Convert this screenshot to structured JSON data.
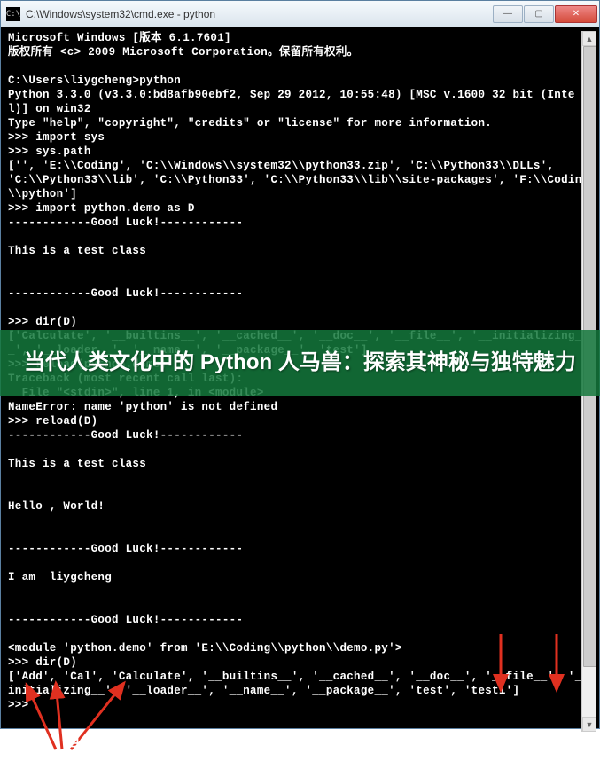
{
  "window": {
    "title": "C:\\Windows\\system32\\cmd.exe - python",
    "icon_glyph": "C:\\",
    "buttons": {
      "minimize": "—",
      "maximize": "▢",
      "close": "✕"
    }
  },
  "terminal": {
    "lines": [
      "Microsoft Windows [版本 6.1.7601]",
      "版权所有 <c> 2009 Microsoft Corporation。保留所有权利。",
      "",
      "C:\\Users\\liygcheng>python",
      "Python 3.3.0 (v3.3.0:bd8afb90ebf2, Sep 29 2012, 10:55:48) [MSC v.1600 32 bit (Intel)] on win32",
      "Type \"help\", \"copyright\", \"credits\" or \"license\" for more information.",
      ">>> import sys",
      ">>> sys.path",
      "['', 'E:\\\\Coding', 'C:\\\\Windows\\\\system32\\\\python33.zip', 'C:\\\\Python33\\\\DLLs', 'C:\\\\Python33\\\\lib', 'C:\\\\Python33', 'C:\\\\Python33\\\\lib\\\\site-packages', 'F:\\\\Coding\\\\python']",
      ">>> import python.demo as D",
      "------------Good Luck!------------",
      "",
      "This is a test class",
      "",
      "",
      "------------Good Luck!------------",
      "",
      ">>> dir(D)",
      "['Calculate', '__builtins__', '__cached__', '__doc__', '__file__', '__initializing__', '__loader__', '__name__', '__package__', 'test']",
      ">>> reload(python.demo)",
      "Traceback (most recent call last):",
      "  File \"<stdin>\", line 1, in <module>",
      "NameError: name 'python' is not defined",
      ">>> reload(D)",
      "------------Good Luck!------------",
      "",
      "This is a test class",
      "",
      "",
      "Hello , World!",
      "",
      "",
      "------------Good Luck!------------",
      "",
      "I am  liygcheng",
      "",
      "",
      "------------Good Luck!------------",
      "",
      "<module 'python.demo' from 'E:\\\\Coding\\\\python\\\\demo.py'>",
      ">>> dir(D)",
      "['Add', 'Cal', 'Calculate', '__builtins__', '__cached__', '__doc__', '__file__', '__initializing__', '__loader__', '__name__', '__package__', 'test', 'test1']",
      ">>> "
    ]
  },
  "overlay": {
    "headline": "当代人类文化中的 Python 人马兽：探索其神秘与独特魅力"
  },
  "footer_label": "半:",
  "arrow_color": "#e03020"
}
